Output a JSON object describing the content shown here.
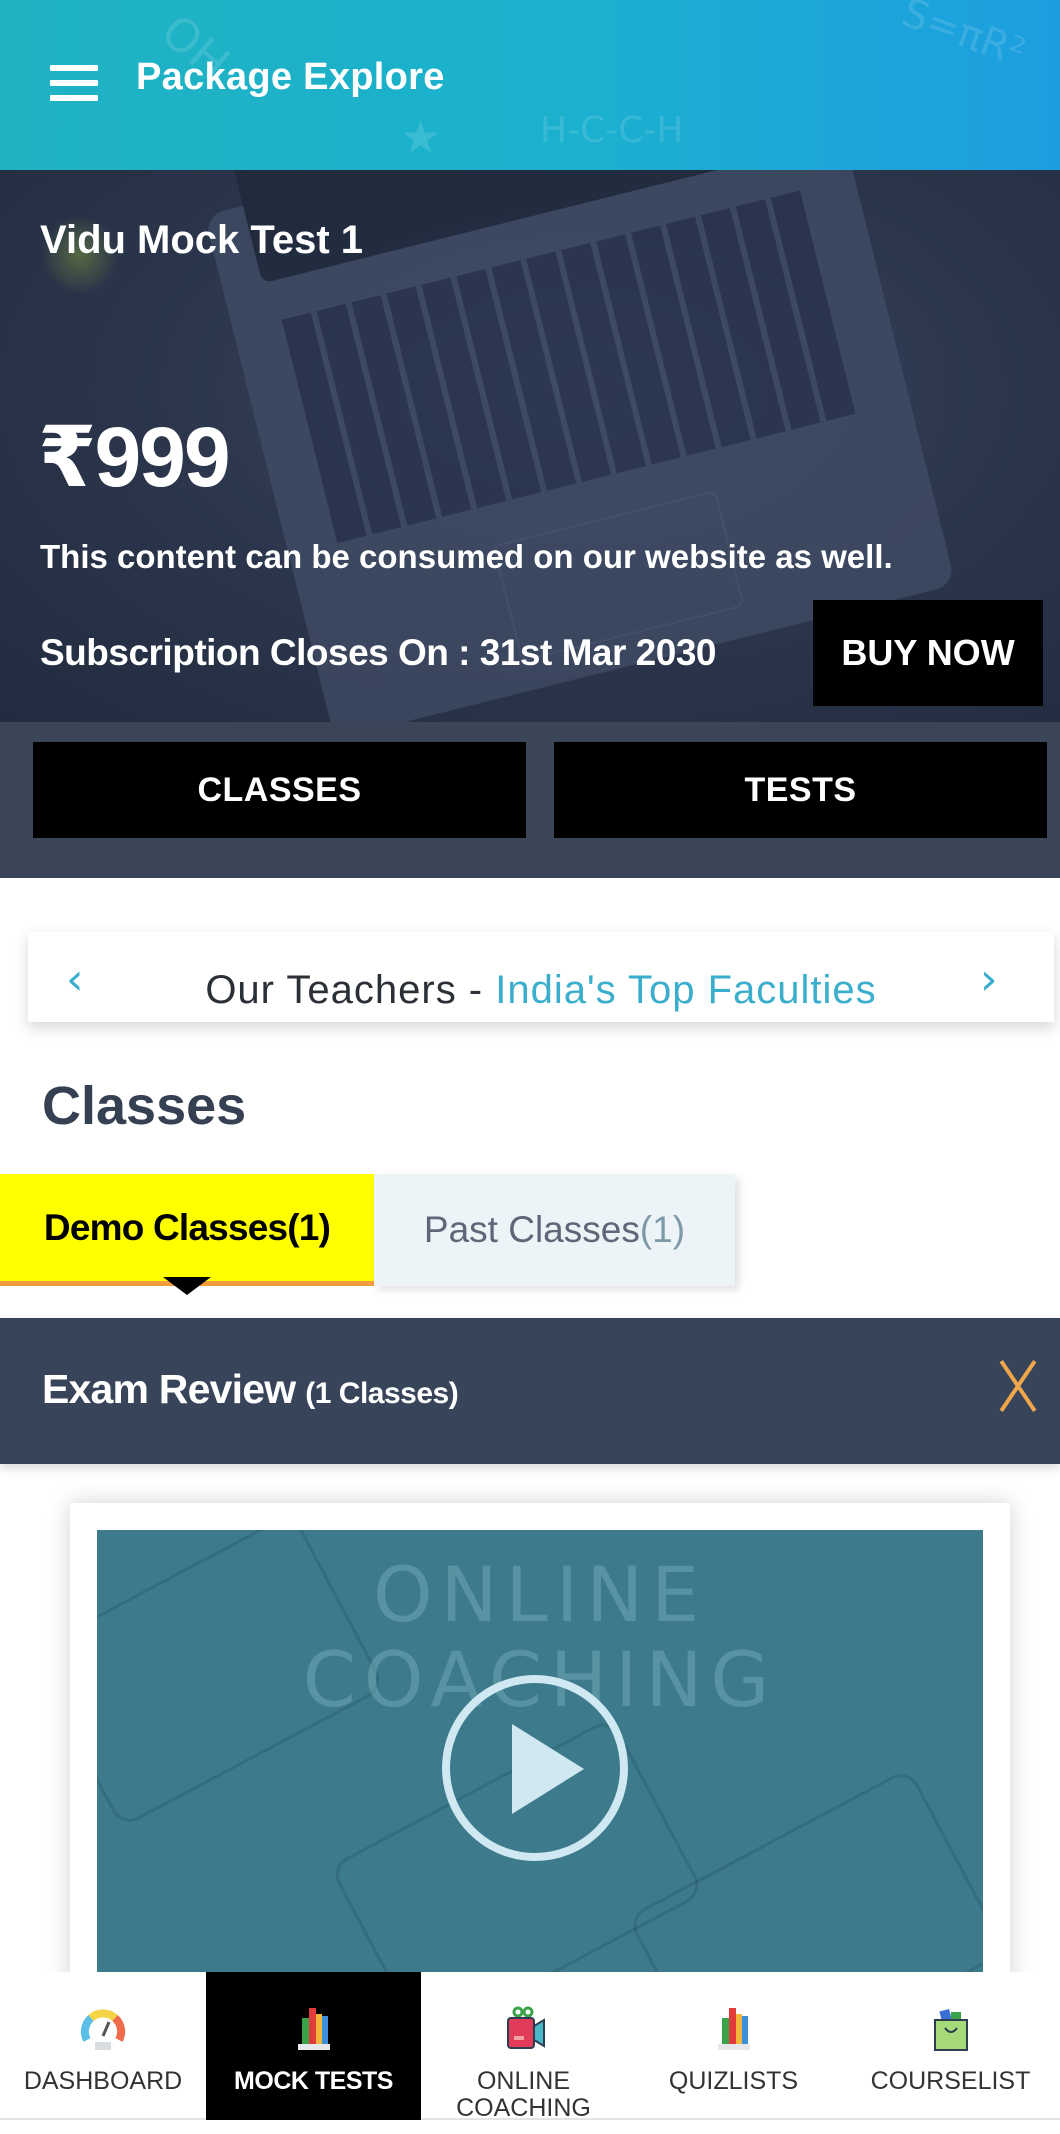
{
  "app_bar": {
    "menu_icon": "hamburger-menu-icon",
    "title": "Package Explore"
  },
  "hero": {
    "package_name": "Vidu Mock Test 1",
    "price": "₹999",
    "note": "This content can be consumed on our website as well.",
    "subscription_closes": "Subscription Closes On : 31st Mar 2030",
    "buy_button": "BUY NOW"
  },
  "section_buttons": {
    "classes": "CLASSES",
    "tests": "TESTS"
  },
  "teachers_banner": {
    "prefix": "Our Teachers - ",
    "highlight": "India's Top Faculties",
    "prev_icon": "‹",
    "next_icon": "›",
    "highlight_color": "#3aaecc"
  },
  "classes": {
    "heading": "Classes",
    "tabs": [
      {
        "label": "Demo Classes(1)",
        "active": true
      },
      {
        "label": "Past Classes",
        "count": "(1)",
        "active": false
      }
    ],
    "group": {
      "title": "Exam Review",
      "count": "(1 Classes)",
      "close_icon": "close-icon"
    },
    "video": {
      "watermark_line1": "ONLINE",
      "watermark_line2": "COACHING",
      "play_icon": "play-icon"
    }
  },
  "bottom_nav": {
    "items": [
      {
        "label": "DASHBOARD",
        "icon": "dashboard-gauge-icon",
        "active": false
      },
      {
        "label": "MOCK TESTS",
        "icon": "books-icon",
        "active": true
      },
      {
        "label": "ONLINE COACHING",
        "icon": "video-camera-icon",
        "active": false
      },
      {
        "label": "QUIZLISTS",
        "icon": "books-icon",
        "active": false
      },
      {
        "label": "COURSELIST",
        "icon": "shopping-bag-icon",
        "active": false
      }
    ]
  },
  "colors": {
    "app_bar": "#1fb3c2",
    "active_tab": "#ffff00",
    "tab_underline": "#f39c3c",
    "group_bar": "#384459",
    "close_icon": "#f0a64a"
  }
}
